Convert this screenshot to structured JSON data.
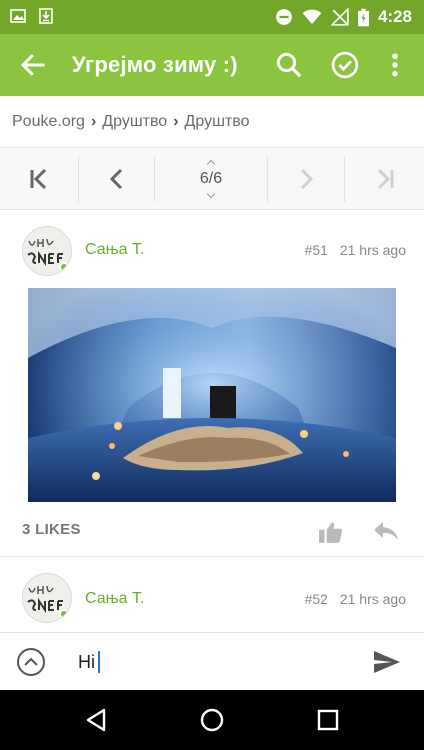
{
  "status_bar": {
    "time": "4:28",
    "left_icons": [
      "image-icon",
      "download-icon"
    ],
    "right_icons": [
      "do-not-disturb-icon",
      "wifi-icon",
      "no-signal-icon",
      "battery-charging-icon"
    ]
  },
  "app_bar": {
    "title": "Угрејмо зиму :)",
    "icons": [
      "back-arrow-icon",
      "search-icon",
      "check-circle-icon",
      "more-vert-icon"
    ]
  },
  "breadcrumb": {
    "items": [
      "Pouke.org",
      "Друштво",
      "Друштво"
    ]
  },
  "pager": {
    "position": "6/6",
    "icons": [
      "first-page-icon",
      "previous-page-icon",
      "next-page-icon",
      "last-page-icon"
    ]
  },
  "posts": [
    {
      "author": "Сања Т.",
      "number": "#51",
      "time": "21 hrs ago",
      "likes": "3 LIKES",
      "has_image": true,
      "online": true
    },
    {
      "author": "Сања Т.",
      "number": "#52",
      "time": "21 hrs ago",
      "online": true
    }
  ],
  "composer": {
    "value": "Hi",
    "icons": [
      "expand-icon",
      "send-icon"
    ]
  },
  "colors": {
    "status_bar": "#72a72a",
    "app_bar": "#8bc43e",
    "author": "#6aad2a"
  }
}
